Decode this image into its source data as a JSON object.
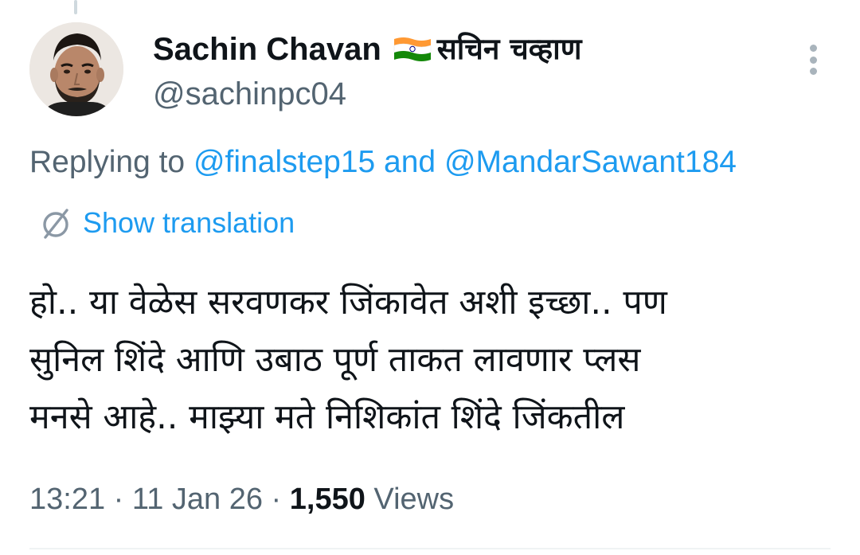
{
  "tweet": {
    "author": {
      "display_name": "Sachin Chavan",
      "flag_icon": "india-flag-icon",
      "display_name_devanagari": "सचिन चव्हाण",
      "handle": "@sachinpc04"
    },
    "reply": {
      "prefix": "Replying to",
      "users": [
        "@finalstep15",
        "@MandarSawant184"
      ],
      "joiner": "and"
    },
    "translate": {
      "icon": "globe-translate-icon",
      "label": "Show translation"
    },
    "text_lines": [
      "हो.. या वेळेस सरवणकर जिंकावेत अशी इच्छा.. पण",
      "सुनिल शिंदे  आणि उबाठ पूर्ण ताकत लावणार प्लस",
      "मनसे आहे.. माझ्या मते निशिकांत शिंदे जिंकतील"
    ],
    "meta": {
      "time": "13:21",
      "separator": "·",
      "date": "11 Jan 26",
      "views_count": "1,550",
      "views_label": "Views"
    }
  },
  "colors": {
    "link": "#1d9bf0",
    "secondary_text": "#536471",
    "primary_text": "#0f1419",
    "divider": "#eff3f4"
  }
}
